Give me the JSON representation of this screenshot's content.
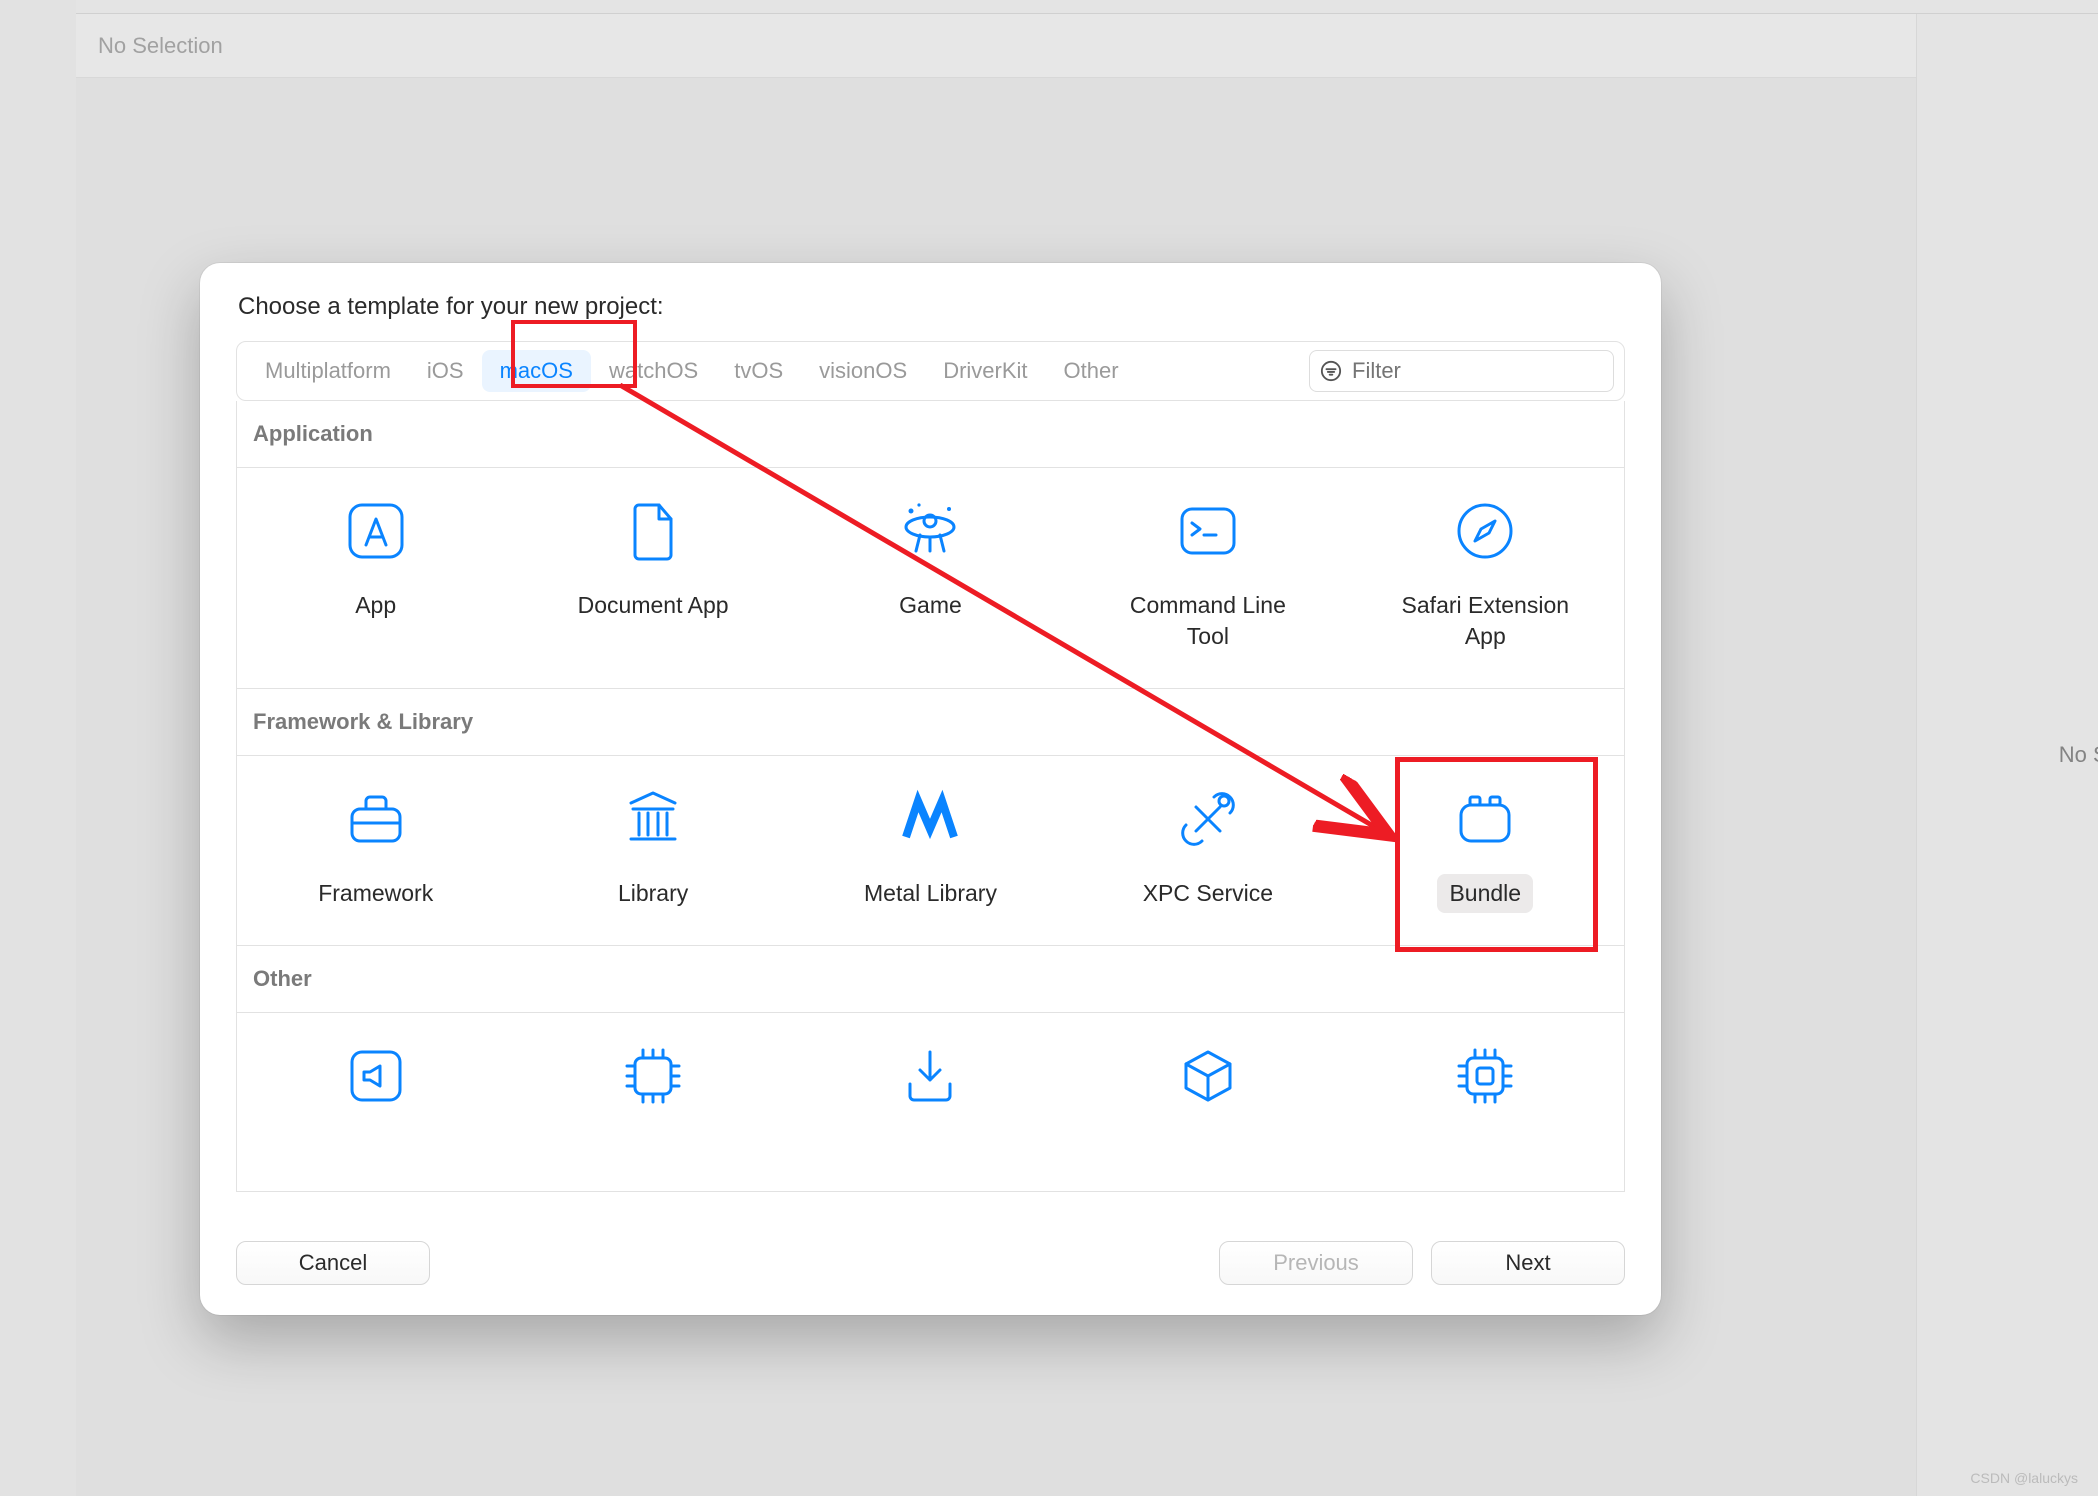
{
  "background": {
    "no_selection": "No Selection",
    "right_panel": "No Selec"
  },
  "modal": {
    "title": "Choose a template for your new project:",
    "platforms": [
      {
        "label": "Multiplatform",
        "selected": false
      },
      {
        "label": "iOS",
        "selected": false
      },
      {
        "label": "macOS",
        "selected": true
      },
      {
        "label": "watchOS",
        "selected": false
      },
      {
        "label": "tvOS",
        "selected": false
      },
      {
        "label": "visionOS",
        "selected": false
      },
      {
        "label": "DriverKit",
        "selected": false
      },
      {
        "label": "Other",
        "selected": false
      }
    ],
    "filter_placeholder": "Filter",
    "sections": [
      {
        "header": "Application",
        "items": [
          {
            "label": "App",
            "icon": "app-icon"
          },
          {
            "label": "Document App",
            "icon": "document-icon"
          },
          {
            "label": "Game",
            "icon": "game-icon"
          },
          {
            "label": "Command Line\nTool",
            "icon": "terminal-icon"
          },
          {
            "label": "Safari Extension\nApp",
            "icon": "safari-icon"
          }
        ]
      },
      {
        "header": "Framework & Library",
        "items": [
          {
            "label": "Framework",
            "icon": "toolbox-icon"
          },
          {
            "label": "Library",
            "icon": "library-icon"
          },
          {
            "label": "Metal Library",
            "icon": "metal-icon"
          },
          {
            "label": "XPC Service",
            "icon": "xpc-icon"
          },
          {
            "label": "Bundle",
            "icon": "bundle-icon",
            "selected": true
          }
        ]
      },
      {
        "header": "Other",
        "items": [
          {
            "label": "",
            "icon": "speaker-icon"
          },
          {
            "label": "",
            "icon": "chip-icon"
          },
          {
            "label": "",
            "icon": "download-chip-icon"
          },
          {
            "label": "",
            "icon": "box3d-icon"
          },
          {
            "label": "",
            "icon": "chip2-icon"
          }
        ]
      }
    ],
    "buttons": {
      "cancel": "Cancel",
      "previous": "Previous",
      "next": "Next"
    }
  },
  "watermark": "CSDN @laluckys"
}
